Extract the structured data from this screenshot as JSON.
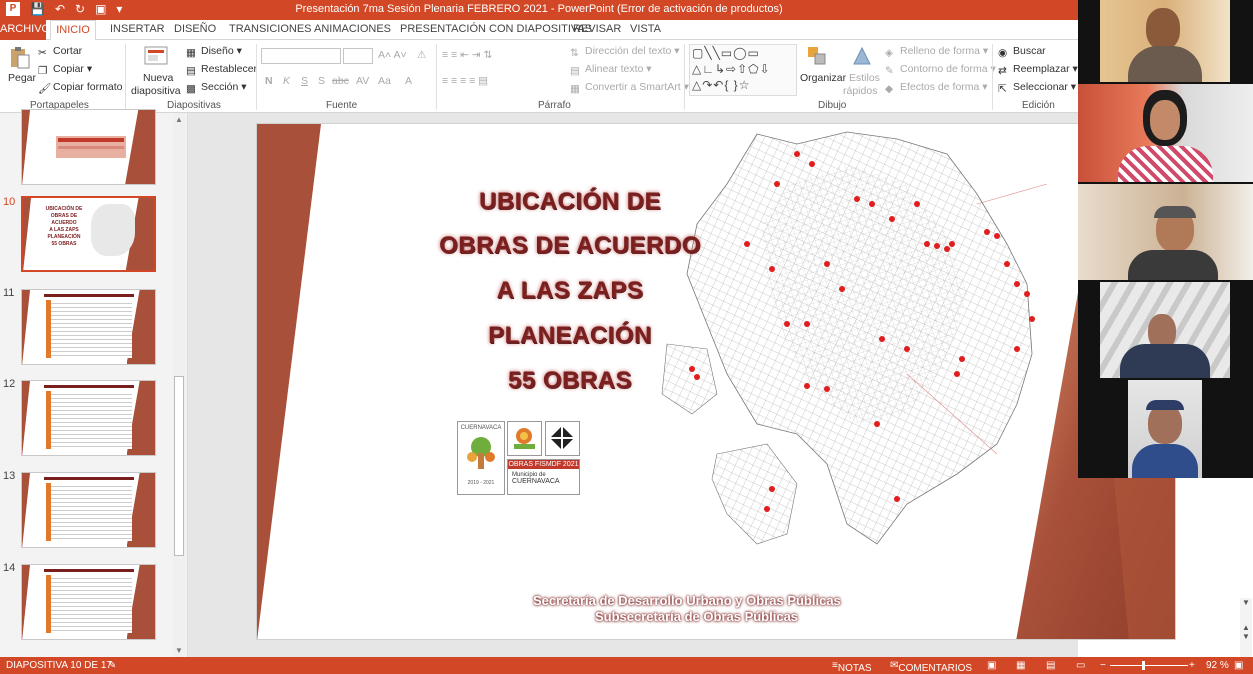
{
  "titlebar": {
    "title": "Presentación 7ma Sesión Plenaria FEBRERO 2021  -  PowerPoint (Error de activación de productos)"
  },
  "tabs": [
    "ARCHIVO",
    "INICIO",
    "INSERTAR",
    "DISEÑO",
    "TRANSICIONES",
    "ANIMACIONES",
    "PRESENTACIÓN CON DIAPOSITIVAS",
    "REVISAR",
    "VISTA"
  ],
  "ribbon": {
    "clipboard": {
      "paste": "Pegar",
      "cut": "Cortar",
      "copy": "Copiar",
      "format_painter": "Copiar formato",
      "label": "Portapapeles"
    },
    "slides": {
      "new_slide_1": "Nueva",
      "new_slide_2": "diapositiva",
      "layout": "Diseño",
      "reset": "Restablecer",
      "section": "Sección",
      "label": "Diapositivas"
    },
    "font": {
      "label": "Fuente",
      "bold": "N",
      "italic": "K",
      "underline": "S",
      "shadow": "S",
      "strike": "abc"
    },
    "paragraph": {
      "text_direction": "Dirección del texto",
      "align_text": "Alinear texto",
      "smartart": "Convertir a SmartArt",
      "label": "Párrafo"
    },
    "drawing": {
      "arrange": "Organizar",
      "quick_styles_1": "Estilos",
      "quick_styles_2": "rápidos",
      "shape_fill": "Relleno de forma",
      "shape_outline": "Contorno de forma",
      "shape_effects": "Efectos de forma",
      "label": "Dibujo"
    },
    "editing": {
      "find": "Buscar",
      "replace": "Reemplazar",
      "select": "Seleccionar",
      "label": "Edición"
    }
  },
  "thumbnails": [
    {
      "num": "",
      "title": "RESUMEN DE PROGRAMA ANUAL DE OBRA"
    },
    {
      "num": "10",
      "title": "UBICACIÓN DE OBRAS DE ACUERDO A LAS ZAPS PLANEACIÓN 55 OBRAS"
    },
    {
      "num": "11",
      "title": "PROGRAMA ANUAL DE OBRA PÚBLICA 2021"
    },
    {
      "num": "12",
      "title": "PROGRAMA ANUAL DE OBRA PÚBLICA 2021"
    },
    {
      "num": "13",
      "title": "PROGRAMA ANUAL DE OBRA PÚBLICA 2021"
    },
    {
      "num": "14",
      "title": "PROGRAMA ANUAL DE OBRA PÚBLICA 2021"
    }
  ],
  "slide": {
    "title_lines": [
      "UBICACIÓN DE",
      "OBRAS DE ACUERDO",
      "A LAS ZAPS",
      "PLANEACIÓN",
      "55 OBRAS"
    ],
    "logo1_text_top": "CUERNAVACA",
    "logo1_years": "2019 - 2021",
    "logo3_text": "OBRAS FISMDF 2021",
    "logo4_text_1": "Municipio de",
    "logo4_text_2": "CUERNAVACA",
    "footer_line1": "Secretaría de Desarrollo Urbano y Obras Públicas",
    "footer_line2": "Subsecretaría de Obras Públicas"
  },
  "statusbar": {
    "slide_info": "DIAPOSITIVA 10 DE 17",
    "notes": "NOTAS",
    "comments": "COMENTARIOS",
    "zoom": "92 %"
  },
  "colors": {
    "accent": "#d24726",
    "title_red": "#7b1e1e",
    "brown": "#a8503a"
  }
}
